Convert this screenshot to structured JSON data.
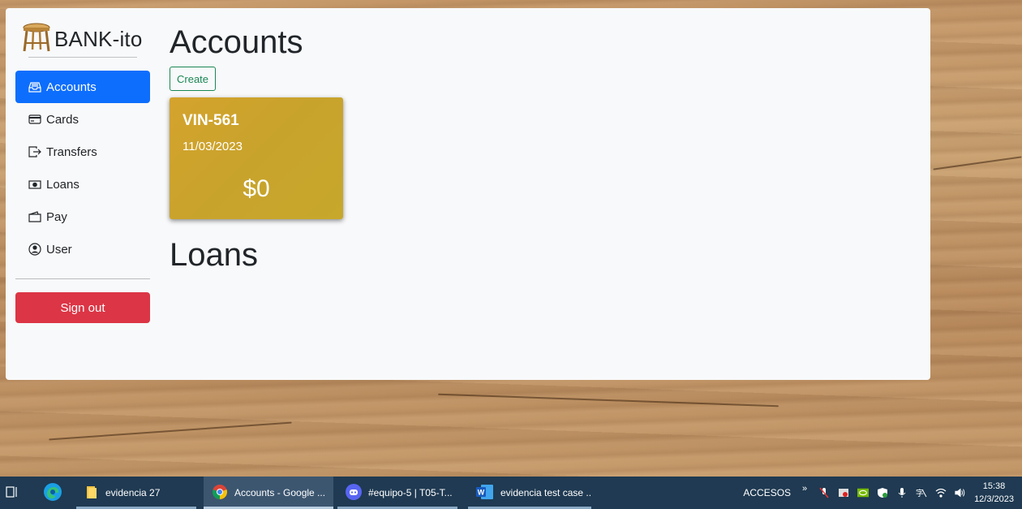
{
  "brand": {
    "name": "BANK-ito"
  },
  "sidebar": {
    "items": [
      {
        "label": "Accounts",
        "icon": "inbox-icon",
        "active": true
      },
      {
        "label": "Cards",
        "icon": "credit-card-icon"
      },
      {
        "label": "Transfers",
        "icon": "box-arrow-right-icon"
      },
      {
        "label": "Loans",
        "icon": "cash-icon"
      },
      {
        "label": "Pay",
        "icon": "wallet-icon"
      },
      {
        "label": "User",
        "icon": "person-circle-icon"
      }
    ],
    "signout_label": "Sign out"
  },
  "main": {
    "accounts_title": "Accounts",
    "create_label": "Create",
    "accounts": [
      {
        "number": "VIN-561",
        "date": "11/03/2023",
        "balance": "$0"
      }
    ],
    "loans_title": "Loans"
  },
  "taskbar": {
    "apps": [
      {
        "label": "evidencia 27",
        "icon": "folder-icon"
      },
      {
        "label": "Accounts - Google ...",
        "icon": "chrome-icon",
        "active": true
      },
      {
        "label": "#equipo-5 | T05-T...",
        "icon": "discord-icon"
      },
      {
        "label": "evidencia test case ...",
        "icon": "word-icon"
      }
    ],
    "accesos": "ACCESOS",
    "time": "15:38",
    "date": "12/3/2023"
  },
  "colors": {
    "primary": "#0d6efd",
    "danger": "#dc3545",
    "success": "#198754",
    "card_gold": "#cfa52c",
    "taskbar": "#1f3a52"
  }
}
